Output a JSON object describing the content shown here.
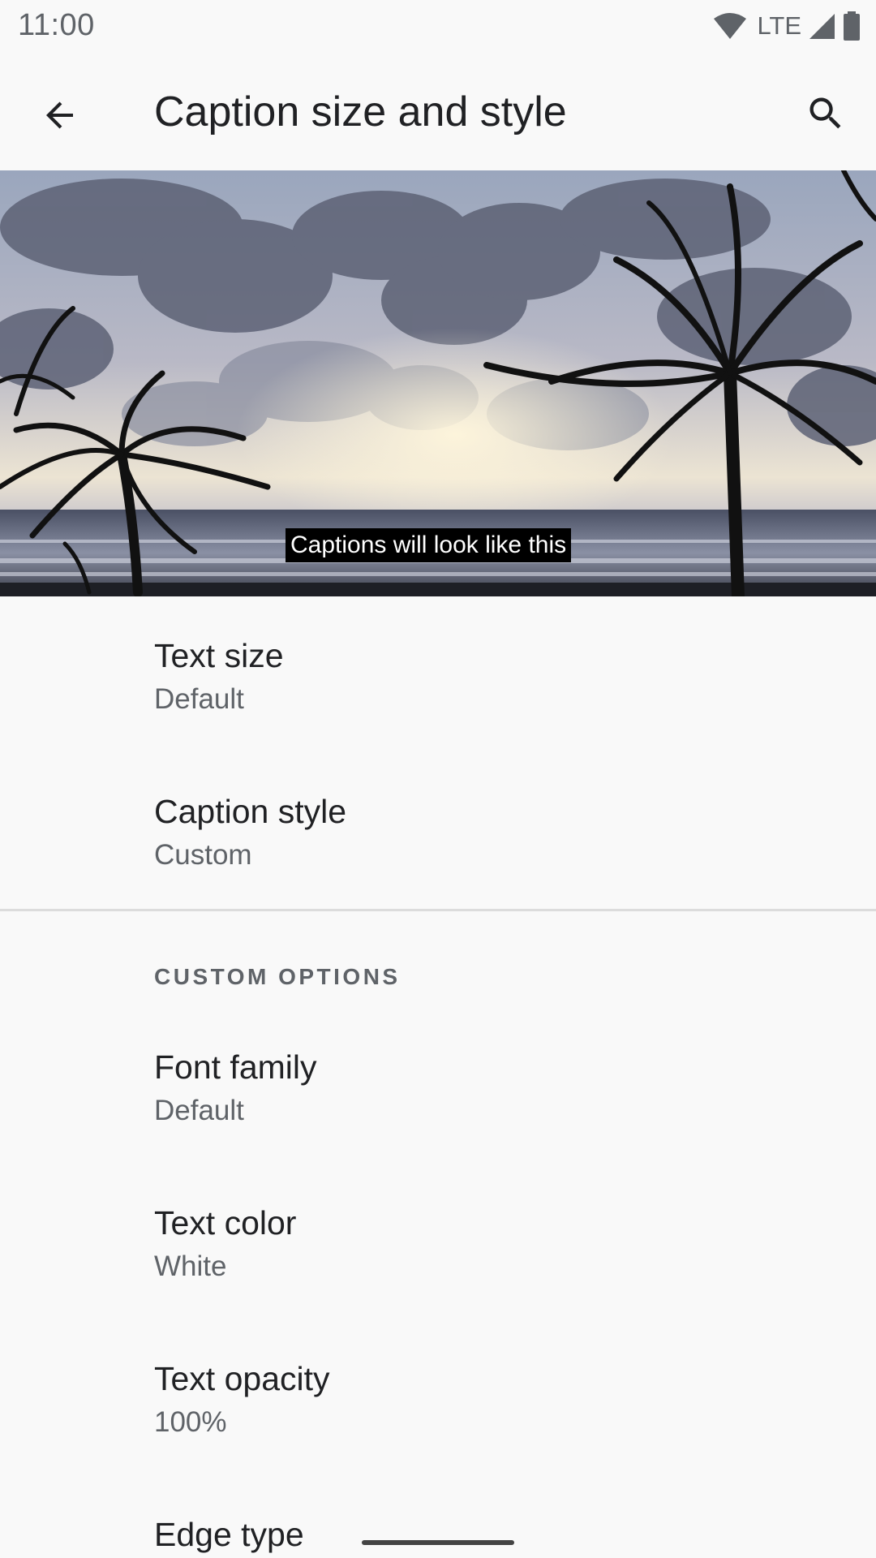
{
  "status_bar": {
    "time": "11:00",
    "network": "LTE",
    "icons": [
      "wifi-icon",
      "lte-indicator",
      "signal-icon",
      "battery-icon"
    ]
  },
  "toolbar": {
    "title": "Caption size and style",
    "back_icon": "arrow-back-icon",
    "search_icon": "search-icon"
  },
  "preview": {
    "caption_text": "Captions will look like this",
    "image": "beach-sunset-with-palm-trees"
  },
  "settings": {
    "text_size": {
      "title": "Text size",
      "summary": "Default"
    },
    "caption_style": {
      "title": "Caption style",
      "summary": "Custom"
    }
  },
  "custom_options": {
    "header": "CUSTOM OPTIONS",
    "font_family": {
      "title": "Font family",
      "summary": "Default"
    },
    "text_color": {
      "title": "Text color",
      "summary": "White"
    },
    "text_opacity": {
      "title": "Text opacity",
      "summary": "100%"
    },
    "edge_type": {
      "title": "Edge type"
    }
  },
  "colors": {
    "background": "#f9f9f9",
    "title_text": "#202124",
    "secondary_text": "#5f6368",
    "caption_background": "#000000",
    "caption_text": "#ffffff"
  }
}
